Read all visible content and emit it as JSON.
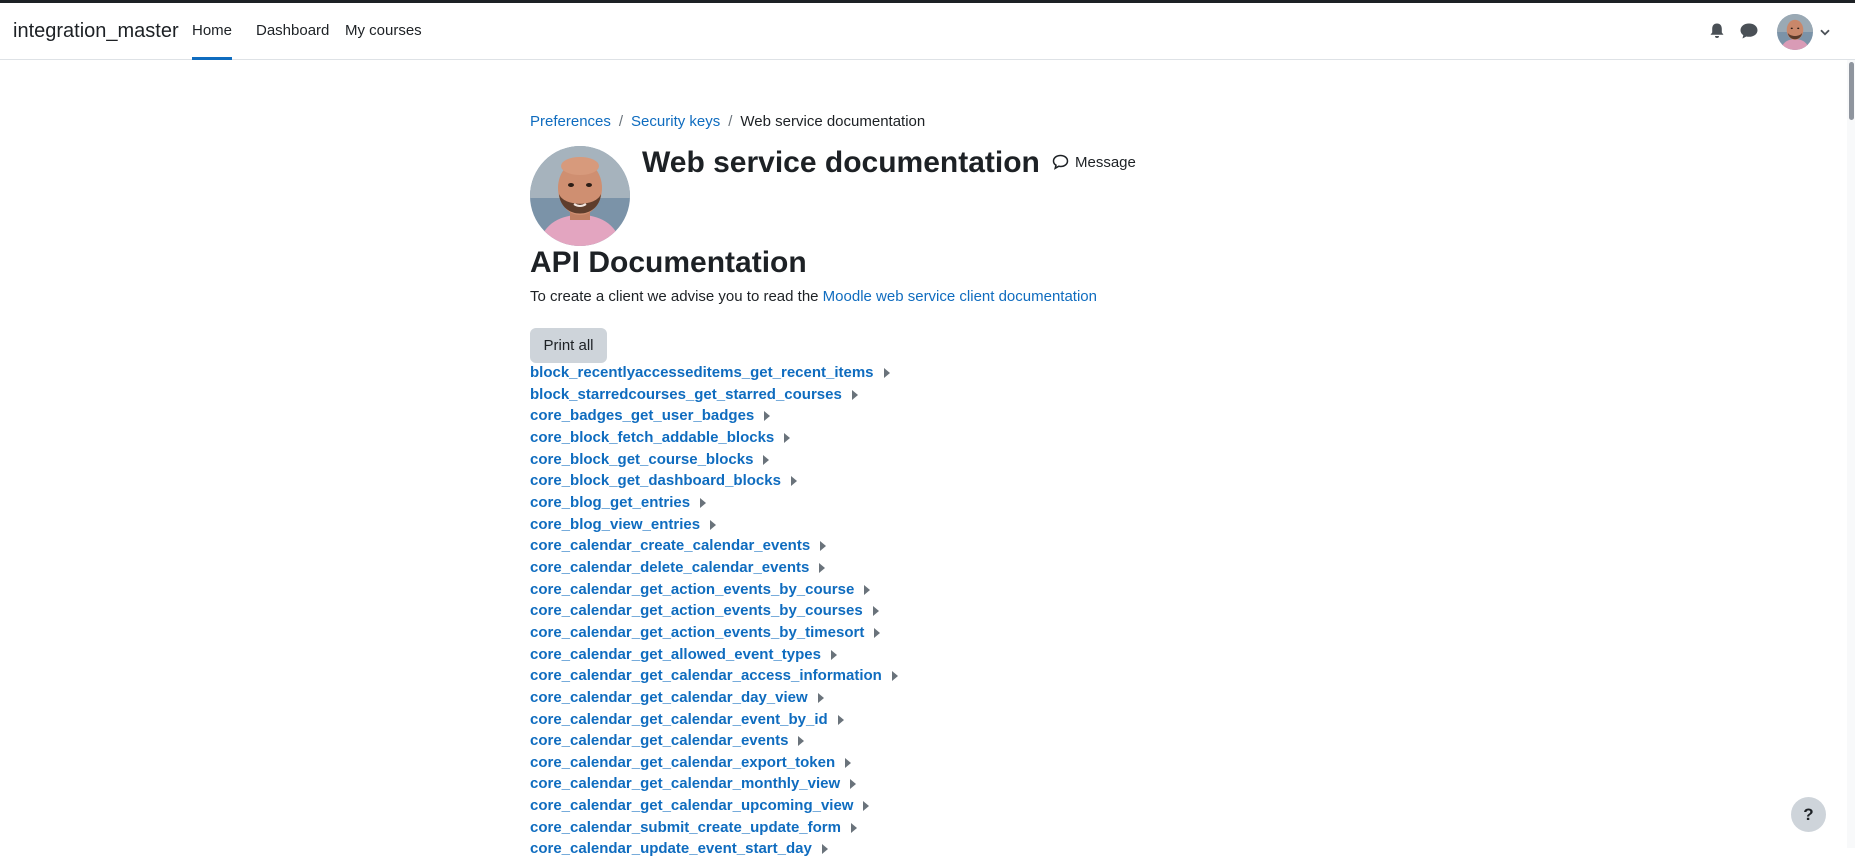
{
  "navbar": {
    "brand": "integration_master",
    "items": [
      {
        "label": "Home",
        "active": true
      },
      {
        "label": "Dashboard",
        "active": false
      },
      {
        "label": "My courses",
        "active": false
      }
    ]
  },
  "breadcrumb": {
    "items": [
      "Preferences",
      "Security keys"
    ],
    "separator": "/",
    "current": "Web service documentation"
  },
  "header": {
    "title": "Web service documentation",
    "message_label": "Message"
  },
  "main": {
    "heading": "API Documentation",
    "intro_text": "To create a client we advise you to read the ",
    "intro_link": "Moodle web service client documentation",
    "print_all_label": "Print all",
    "functions": [
      "block_recentlyaccesseditems_get_recent_items",
      "block_starredcourses_get_starred_courses",
      "core_badges_get_user_badges",
      "core_block_fetch_addable_blocks",
      "core_block_get_course_blocks",
      "core_block_get_dashboard_blocks",
      "core_blog_get_entries",
      "core_blog_view_entries",
      "core_calendar_create_calendar_events",
      "core_calendar_delete_calendar_events",
      "core_calendar_get_action_events_by_course",
      "core_calendar_get_action_events_by_courses",
      "core_calendar_get_action_events_by_timesort",
      "core_calendar_get_allowed_event_types",
      "core_calendar_get_calendar_access_information",
      "core_calendar_get_calendar_day_view",
      "core_calendar_get_calendar_event_by_id",
      "core_calendar_get_calendar_events",
      "core_calendar_get_calendar_export_token",
      "core_calendar_get_calendar_monthly_view",
      "core_calendar_get_calendar_upcoming_view",
      "core_calendar_submit_create_update_form",
      "core_calendar_update_event_start_day"
    ]
  },
  "help": {
    "label": "?"
  },
  "colors": {
    "link": "#0f6cbf",
    "text": "#1d2125",
    "button_bg": "#ced4da",
    "border": "#dee2e6"
  },
  "icons": {
    "nav": [
      "bell-icon",
      "chat-icon",
      "chevron-down-icon"
    ],
    "message": "speech-bubble-icon",
    "expand": "caret-right-icon"
  }
}
